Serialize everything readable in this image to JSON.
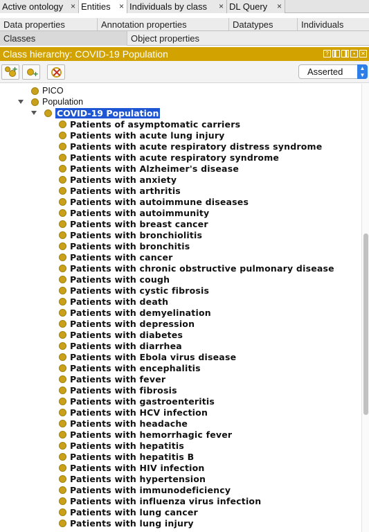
{
  "tabs": [
    {
      "label": "Active ontology",
      "close": "×"
    },
    {
      "label": "Entities",
      "close": "×",
      "active": true
    },
    {
      "label": "Individuals by class",
      "close": "×"
    },
    {
      "label": "DL Query",
      "close": "×"
    }
  ],
  "subtabs_row1": [
    "Data properties",
    "Annotation properties",
    "Datatypes",
    "Individuals"
  ],
  "subtabs_row2": [
    "Classes",
    "Object properties"
  ],
  "panel": {
    "title": "Class hierarchy: COVID-19 Population",
    "title_icons": [
      "?",
      "▌",
      "▐",
      "▪",
      "✕"
    ],
    "mode_select": "Asserted",
    "accent_color": "#d2a300",
    "selection_color": "#1f56d3"
  },
  "toolbar": {
    "add_subclass_icon": "add-subclass-icon",
    "add_sibling_icon": "add-sibling-icon",
    "delete_icon": "delete-class-icon"
  },
  "tree": {
    "pico": "PICO",
    "population": "Population",
    "selected": "COVID-19 Population",
    "children": [
      "Patients of asymptomatic carriers",
      "Patients with acute lung injury",
      "Patients with acute respiratory distress syndrome",
      "Patients with acute respiratory syndrome",
      "Patients with Alzheimer's disease",
      "Patients with anxiety",
      "Patients with arthritis",
      "Patients with autoimmune diseases",
      "Patients with autoimmunity",
      "Patients with breast cancer",
      "Patients with bronchiolitis",
      "Patients with bronchitis",
      "Patients with cancer",
      "Patients with chronic obstructive pulmonary disease",
      "Patients with cough",
      "Patients with cystic fibrosis",
      "Patients with death",
      "Patients with demyelination",
      "Patients with depression",
      "Patients with diabetes",
      "Patients with diarrhea",
      "Patients with Ebola virus disease",
      "Patients with encephalitis",
      "Patients with fever",
      "Patients with fibrosis",
      "Patients with gastroenteritis",
      "Patients with HCV infection",
      "Patients with headache",
      "Patients with hemorrhagic fever",
      "Patients with hepatitis",
      "Patients with hepatitis B",
      "Patients with HIV infection",
      "Patients with hypertension",
      "Patients with immunodeficiency",
      "Patients with influenza virus infection",
      "Patients with lung cancer",
      "Patients with lung injury"
    ]
  }
}
